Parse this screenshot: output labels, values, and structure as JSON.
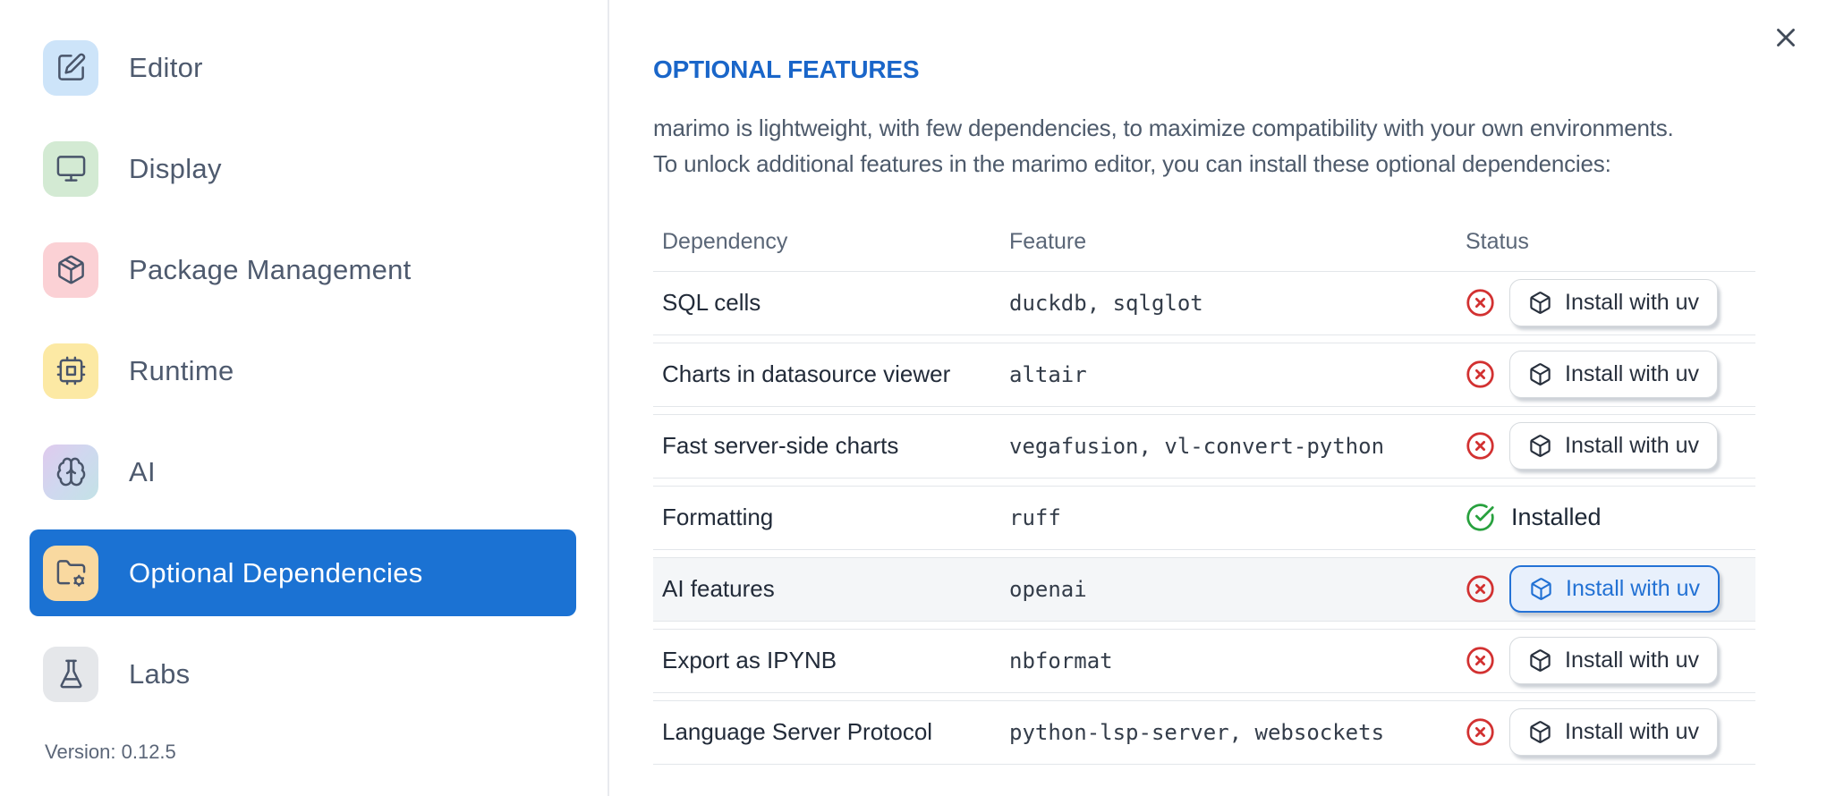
{
  "sidebar": {
    "items": [
      {
        "label": "Editor",
        "icon": "square-pen-icon",
        "icon_bg": "#cde4f9",
        "selected": false
      },
      {
        "label": "Display",
        "icon": "monitor-icon",
        "icon_bg": "#d3ead3",
        "selected": false
      },
      {
        "label": "Package Management",
        "icon": "package-icon",
        "icon_bg": "#fbd1d5",
        "selected": false
      },
      {
        "label": "Runtime",
        "icon": "cpu-icon",
        "icon_bg": "#fce9a4",
        "selected": false
      },
      {
        "label": "AI",
        "icon": "brain-icon",
        "icon_bg": "linear-gradient(130deg,#dfcaed 0%,#cfd8ef 50%,#c3e2e6 100%)",
        "selected": false
      },
      {
        "label": "Optional Dependencies",
        "icon": "folder-cog-icon",
        "icon_bg": "#f9d9a0",
        "selected": true
      },
      {
        "label": "Labs",
        "icon": "flask-icon",
        "icon_bg": "#e5e7ea",
        "selected": false
      }
    ],
    "version_label": "Version: 0.12.5"
  },
  "panel": {
    "title": "OPTIONAL FEATURES",
    "description": [
      "marimo is lightweight, with few dependencies, to maximize compatibility with your own environments.",
      "To unlock additional features in the marimo editor, you can install these optional dependencies:"
    ],
    "close_icon": "x-icon"
  },
  "table": {
    "headers": [
      "Dependency",
      "Feature",
      "Status"
    ],
    "installed_label": "Installed",
    "install_button_label": "Install with uv",
    "rows": [
      {
        "dependency": "SQL cells",
        "feature": "duckdb, sqlglot",
        "installed": false,
        "highlighted": false
      },
      {
        "dependency": "Charts in datasource viewer",
        "feature": "altair",
        "installed": false,
        "highlighted": false
      },
      {
        "dependency": "Fast server-side charts",
        "feature": "vegafusion, vl-convert-python",
        "installed": false,
        "highlighted": false
      },
      {
        "dependency": "Formatting",
        "feature": "ruff",
        "installed": true,
        "highlighted": false
      },
      {
        "dependency": "AI features",
        "feature": "openai",
        "installed": false,
        "highlighted": true
      },
      {
        "dependency": "Export as IPYNB",
        "feature": "nbformat",
        "installed": false,
        "highlighted": false
      },
      {
        "dependency": "Language Server Protocol",
        "feature": "python-lsp-server, websockets",
        "installed": false,
        "highlighted": false
      }
    ]
  },
  "colors": {
    "accent_blue": "#1b72d3",
    "title_blue": "#1a66c9",
    "error_red": "#d23131",
    "success_green": "#28a13e"
  }
}
